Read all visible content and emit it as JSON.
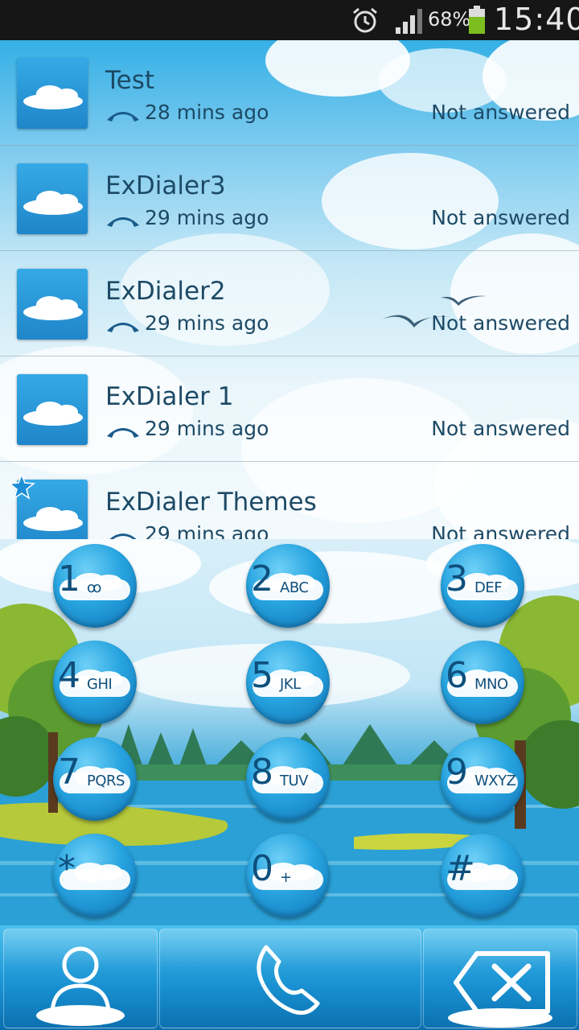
{
  "status_bar": {
    "battery_percent": "68%",
    "time": "15:40",
    "icons": [
      "alarm-icon",
      "signal-icon",
      "battery-icon"
    ]
  },
  "call_log": [
    {
      "name": "Test",
      "time": "28 mins ago",
      "status": "Not answered",
      "favorite": false
    },
    {
      "name": "ExDialer3",
      "time": "29 mins ago",
      "status": "Not answered",
      "favorite": false
    },
    {
      "name": "ExDialer2",
      "time": "29 mins ago",
      "status": "Not answered",
      "favorite": false
    },
    {
      "name": "ExDialer 1",
      "time": "29 mins ago",
      "status": "Not answered",
      "favorite": false
    },
    {
      "name": "ExDialer Themes",
      "time": "29 mins ago",
      "status": "Not answered",
      "favorite": true
    }
  ],
  "keypad": [
    {
      "digit": "1",
      "letters": "ꝏ"
    },
    {
      "digit": "2",
      "letters": "ABC"
    },
    {
      "digit": "3",
      "letters": "DEF"
    },
    {
      "digit": "4",
      "letters": "GHI"
    },
    {
      "digit": "5",
      "letters": "JKL"
    },
    {
      "digit": "6",
      "letters": "MNO"
    },
    {
      "digit": "7",
      "letters": "PQRS"
    },
    {
      "digit": "8",
      "letters": "TUV"
    },
    {
      "digit": "9",
      "letters": "WXYZ"
    },
    {
      "digit": "*",
      "letters": ""
    },
    {
      "digit": "0",
      "letters": "+"
    },
    {
      "digit": "#",
      "letters": ""
    }
  ],
  "bottom_bar": {
    "buttons": [
      "contacts-icon",
      "phone-icon",
      "backspace-icon"
    ]
  },
  "colors": {
    "text": "#1d4a66",
    "key_blue": "#27a4e0",
    "status_bar": "#161616"
  }
}
